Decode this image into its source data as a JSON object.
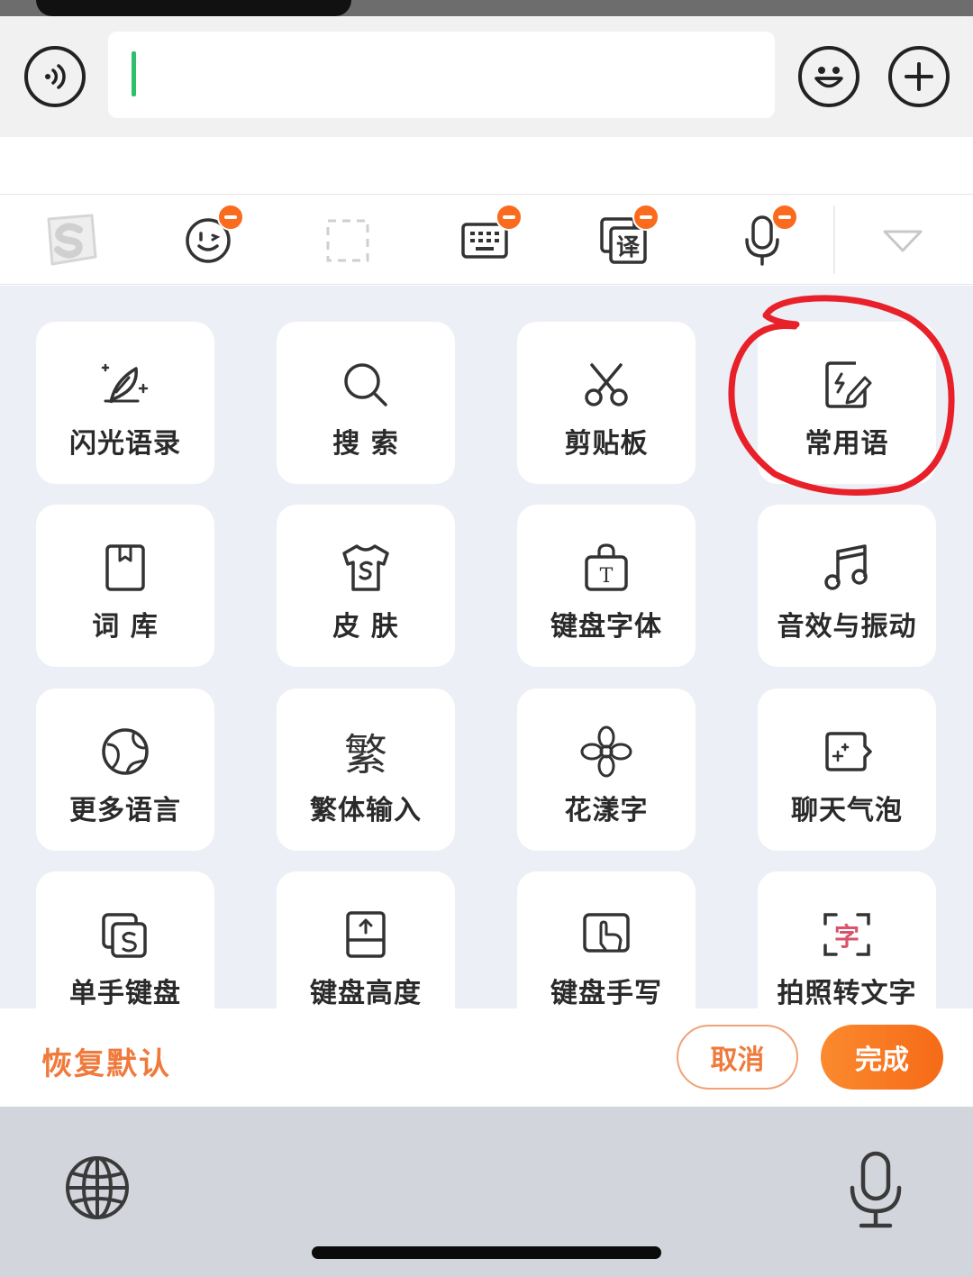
{
  "input_bar": {
    "voice_icon": "voice-wave-icon",
    "emoji_icon": "smiley-icon",
    "add_icon": "plus-icon",
    "caret_color": "#2fbf6b"
  },
  "toolbar": {
    "items": [
      {
        "icon": "sogou-logo-icon",
        "badge": false
      },
      {
        "icon": "emoji-face-icon",
        "badge": true
      },
      {
        "icon": "dashed-square-icon",
        "badge": false
      },
      {
        "icon": "keyboard-icon",
        "badge": true
      },
      {
        "icon": "translate-icon",
        "badge": true,
        "glyph": "译"
      },
      {
        "icon": "microphone-icon",
        "badge": true
      },
      {
        "icon": "collapse-triangle-icon",
        "badge": false
      }
    ],
    "badge_color": "#fa6b1e"
  },
  "grid": {
    "tiles": [
      {
        "label": "闪光语录",
        "icon": "quill-sparkle-icon"
      },
      {
        "label": "搜 索",
        "icon": "search-icon"
      },
      {
        "label": "剪贴板",
        "icon": "scissors-icon"
      },
      {
        "label": "常用语",
        "icon": "quick-phrase-icon",
        "highlighted": true
      },
      {
        "label": "词 库",
        "icon": "book-icon"
      },
      {
        "label": "皮 肤",
        "icon": "tshirt-icon"
      },
      {
        "label": "键盘字体",
        "icon": "font-bag-icon",
        "glyph": "T"
      },
      {
        "label": "音效与振动",
        "icon": "music-note-icon"
      },
      {
        "label": "更多语言",
        "icon": "globe-icon"
      },
      {
        "label": "繁体输入",
        "icon": "traditional-char-icon",
        "glyph": "繁"
      },
      {
        "label": "花漾字",
        "icon": "flower-icon"
      },
      {
        "label": "聊天气泡",
        "icon": "chat-bubble-icon"
      },
      {
        "label": "单手键盘",
        "icon": "one-hand-keyboard-icon"
      },
      {
        "label": "键盘高度",
        "icon": "keyboard-height-icon"
      },
      {
        "label": "键盘手写",
        "icon": "handwriting-icon"
      },
      {
        "label": "拍照转文字",
        "icon": "photo-to-text-icon",
        "glyph": "字"
      }
    ],
    "highlight_color": "#e8202a"
  },
  "actions": {
    "restore_label": "恢复默认",
    "cancel_label": "取消",
    "done_label": "完成",
    "accent_color": "#f66a17"
  },
  "system_bar": {
    "globe_icon": "globe-icon",
    "mic_icon": "dictation-mic-icon"
  }
}
